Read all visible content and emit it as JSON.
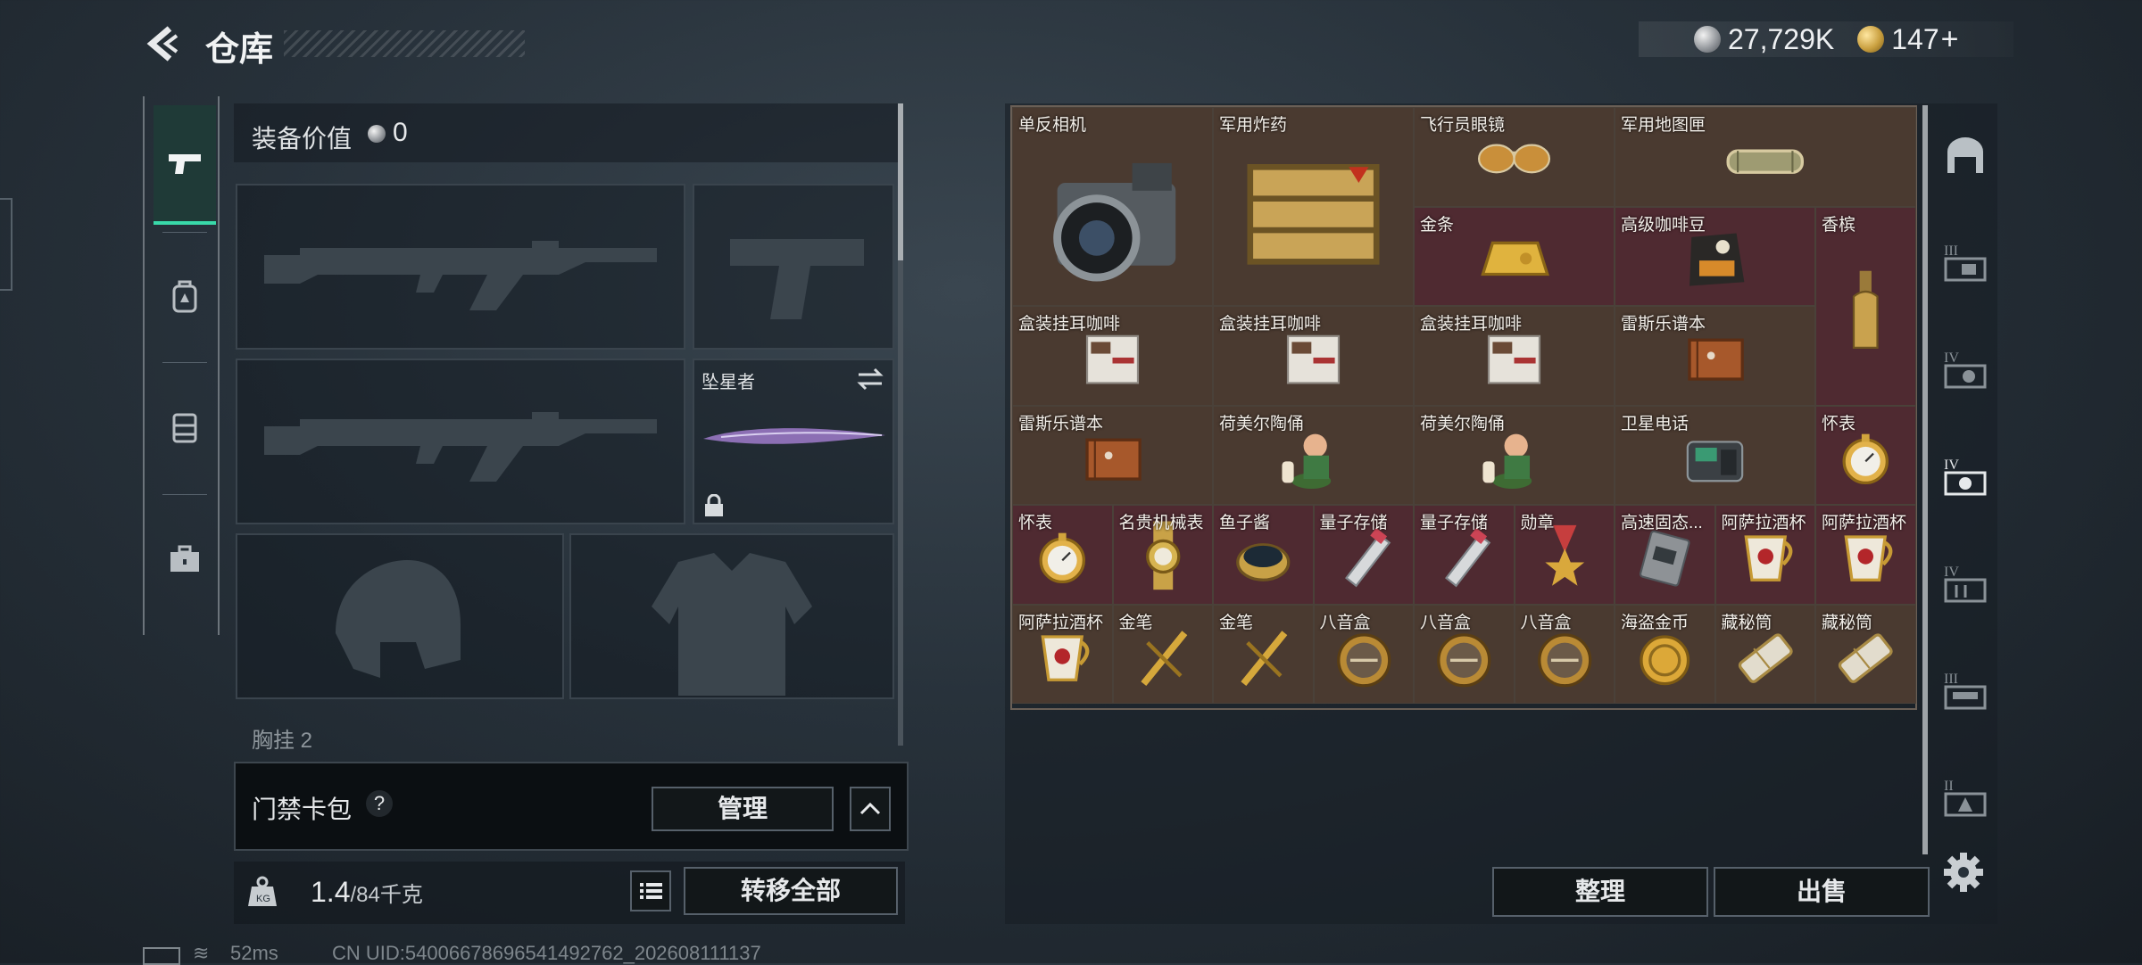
{
  "header": {
    "title": "仓库",
    "silver": "27,729K",
    "gold": "147",
    "plus": "+"
  },
  "left_tabs": [
    "weapon-tab-icon",
    "backpack-tab-icon",
    "vest-tab-icon",
    "toolbox-tab-icon"
  ],
  "loadout": {
    "equipment_value_label": "装备价值",
    "equipment_value": "0",
    "knife_name": "坠星者",
    "chest_label": "胸挂",
    "chest_count": "2"
  },
  "key_case": {
    "label": "门禁卡包",
    "help": "?",
    "manage": "管理"
  },
  "weight": {
    "current": "1.4",
    "unit": "/84千克",
    "transfer_all": "转移全部"
  },
  "stash": {
    "items": [
      {
        "name": "单反相机",
        "color": "brown",
        "icon": "camera"
      },
      {
        "name": "军用炸药",
        "color": "brown",
        "icon": "crate"
      },
      {
        "name": "飞行员眼镜",
        "color": "brown",
        "icon": "glasses"
      },
      {
        "name": "军用地图匣",
        "color": "brown",
        "icon": "tube"
      },
      {
        "name": "金条",
        "color": "red",
        "icon": "goldbar"
      },
      {
        "name": "高级咖啡豆",
        "color": "red",
        "icon": "coffeebag"
      },
      {
        "name": "香槟",
        "color": "red",
        "icon": "bottle"
      },
      {
        "name": "盒装挂耳咖啡",
        "color": "brown",
        "icon": "box"
      },
      {
        "name": "盒装挂耳咖啡",
        "color": "brown",
        "icon": "box"
      },
      {
        "name": "盒装挂耳咖啡",
        "color": "brown",
        "icon": "box"
      },
      {
        "name": "雷斯乐谱本",
        "color": "brown",
        "icon": "book"
      },
      {
        "name": "雷斯乐谱本",
        "color": "brown",
        "icon": "book"
      },
      {
        "name": "荷美尔陶俑",
        "color": "brown",
        "icon": "figurine"
      },
      {
        "name": "荷美尔陶俑",
        "color": "brown",
        "icon": "figurine"
      },
      {
        "name": "卫星电话",
        "color": "brown",
        "icon": "phone"
      },
      {
        "name": "怀表",
        "color": "red",
        "icon": "watch"
      },
      {
        "name": "怀表",
        "color": "red",
        "icon": "watch"
      },
      {
        "name": "名贵机械表",
        "color": "red",
        "icon": "wristwatch"
      },
      {
        "name": "鱼子酱",
        "color": "red",
        "icon": "caviar"
      },
      {
        "name": "量子存储",
        "color": "red",
        "icon": "usb"
      },
      {
        "name": "量子存储",
        "color": "red",
        "icon": "usb"
      },
      {
        "name": "勋章",
        "color": "red",
        "icon": "medal"
      },
      {
        "name": "高速固态...",
        "color": "red",
        "icon": "ssd"
      },
      {
        "name": "阿萨拉酒杯",
        "color": "red",
        "icon": "cup"
      },
      {
        "name": "阿萨拉酒杯",
        "color": "red",
        "icon": "cup"
      },
      {
        "name": "阿萨拉酒杯",
        "color": "brown",
        "icon": "cup"
      },
      {
        "name": "金笔",
        "color": "brown",
        "icon": "pen"
      },
      {
        "name": "金笔",
        "color": "brown",
        "icon": "pen"
      },
      {
        "name": "八音盒",
        "color": "brown",
        "icon": "musicbox"
      },
      {
        "name": "八音盒",
        "color": "brown",
        "icon": "musicbox"
      },
      {
        "name": "八音盒",
        "color": "brown",
        "icon": "musicbox"
      },
      {
        "name": "海盗金币",
        "color": "brown",
        "icon": "coin"
      },
      {
        "name": "藏秘筒",
        "color": "brown",
        "icon": "cryptex"
      },
      {
        "name": "藏秘筒",
        "color": "brown",
        "icon": "cryptex"
      }
    ],
    "sort": "整理",
    "sell": "出售"
  },
  "right_tabs": [
    "house-tab-icon",
    "III",
    "IV",
    "IV",
    "IV",
    "III",
    "II"
  ],
  "status": {
    "ping": "52ms",
    "uid": "CN UID:540066786965414927​62_202608111137"
  },
  "colors": {
    "accent": "#39d9a9",
    "brown_cell": "#4a3a30",
    "red_cell": "#4f2a31"
  }
}
